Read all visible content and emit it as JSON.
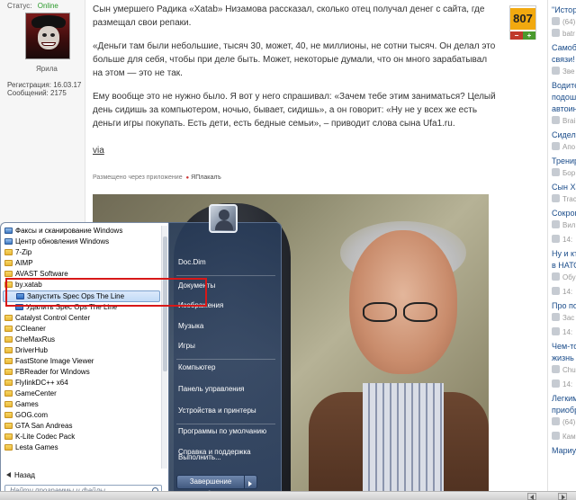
{
  "user": {
    "status_label": "Статус:",
    "status_value": "Online",
    "name": "Ярила",
    "registered": "Регистрация: 16.03.17",
    "messages": "Сообщений: 2175"
  },
  "article": {
    "p1": "Сын умершего Радика «Xatab» Низамова рассказал, сколько отец получал денег с сайта, где размещал свои репаки.",
    "p2": "«Деньги там были небольшие, тысяч 30, может, 40, не миллионы, не сотни тысяч. Он делал это больше для себя, чтобы при деле быть. Может, некоторые думали, что он много зарабатывал на этом — это не так.",
    "p3": "Ему вообще это не нужно было. Я вот у него спрашивал: «Зачем тебе этим заниматься? Целый день сидишь за компьютером, ночью, бывает, сидишь», а он говорит: «Ну не у всех же есть деньги игры покупать. Есть дети, есть бедные семьи», – приводит слова сына Ufa1.ru.",
    "via": "via",
    "posted_prefix": "Размещено через приложение",
    "posted_app": "ЯПлакалъ"
  },
  "rating": {
    "value": "807",
    "minus": "−",
    "plus": "+"
  },
  "rightbar": {
    "items": [
      {
        "title": "\"Истор",
        "meta": "(64)"
      },
      {
        "title": "",
        "meta": "batr"
      },
      {
        "title": "Самобы",
        "meta": ""
      },
      {
        "title": "связи!",
        "meta": ""
      },
      {
        "title": "",
        "meta": "Зве"
      },
      {
        "title": "Водите",
        "meta": ""
      },
      {
        "title": "подошл",
        "meta": ""
      },
      {
        "title": "автоин",
        "meta": ""
      },
      {
        "title": "",
        "meta": "Brai"
      },
      {
        "title": "Сидела",
        "meta": ""
      },
      {
        "title": "",
        "meta": "Апо"
      },
      {
        "title": "Тренир",
        "meta": ""
      },
      {
        "title": "",
        "meta": "Бор"
      },
      {
        "title": "Сын Ха",
        "meta": ""
      },
      {
        "title": "",
        "meta": "Trac"
      },
      {
        "title": "Сокрoп",
        "meta": ""
      },
      {
        "title": "",
        "meta": "Вил"
      },
      {
        "title": "",
        "meta": "14:"
      },
      {
        "title": "Ну и кт",
        "meta": ""
      },
      {
        "title": "в НАТО",
        "meta": ""
      },
      {
        "title": "",
        "meta": "Обу"
      },
      {
        "title": "",
        "meta": "14:"
      },
      {
        "title": "Про по",
        "meta": ""
      },
      {
        "title": "",
        "meta": "Зас"
      },
      {
        "title": "",
        "meta": "14:"
      },
      {
        "title": "Чем-то",
        "meta": ""
      },
      {
        "title": "жизнь",
        "meta": ""
      },
      {
        "title": "",
        "meta": "Chu"
      },
      {
        "title": "",
        "meta": "14:"
      },
      {
        "title": "Легким",
        "meta": ""
      },
      {
        "title": "приобр",
        "meta": ""
      },
      {
        "title": "",
        "meta": "(64)"
      },
      {
        "title": "",
        "meta": "Кам"
      },
      {
        "title": "Мариу",
        "meta": ""
      }
    ]
  },
  "startmenu": {
    "programs": [
      {
        "label": "Факсы и сканирование Windows",
        "type": "app"
      },
      {
        "label": "Центр обновления Windows",
        "type": "app"
      },
      {
        "label": "7-Zip",
        "type": "folder"
      },
      {
        "label": "AIMP",
        "type": "folder"
      },
      {
        "label": "AVAST Software",
        "type": "folder"
      },
      {
        "label": "by.xatab",
        "type": "folder"
      },
      {
        "label": "Запустить Spec Ops The Line",
        "type": "sub-hl"
      },
      {
        "label": "Удалить Spec Ops The Line",
        "type": "sub"
      },
      {
        "label": "Catalyst Control Center",
        "type": "folder"
      },
      {
        "label": "CCleaner",
        "type": "folder"
      },
      {
        "label": "CheMaxRus",
        "type": "folder"
      },
      {
        "label": "DriverHub",
        "type": "folder"
      },
      {
        "label": "FastStone Image Viewer",
        "type": "folder"
      },
      {
        "label": "FBReader for Windows",
        "type": "folder"
      },
      {
        "label": "FlylinkDC++ x64",
        "type": "folder"
      },
      {
        "label": "GameCenter",
        "type": "folder"
      },
      {
        "label": "Games",
        "type": "folder"
      },
      {
        "label": "GOG.com",
        "type": "folder"
      },
      {
        "label": "GTA San Andreas",
        "type": "folder"
      },
      {
        "label": "K-Lite Codec Pack",
        "type": "folder"
      },
      {
        "label": "Lesta Games",
        "type": "folder"
      }
    ],
    "back_label": "Назад",
    "search_placeholder": "Найти программы и файлы",
    "right_items": [
      "Doc.Dim",
      "Документы",
      "Изображения",
      "Музыка",
      "Игры",
      "Компьютер",
      "Панель управления",
      "Устройства и принтеры",
      "Программы по умолчанию",
      "Справка и поддержка",
      "Выполнить..."
    ],
    "shutdown_label": "Завершение работы"
  },
  "colors": {
    "online": "#2b9a2b",
    "rating_bg": "#f2a90f",
    "highlight_box": "#d81818",
    "link": "#1a4c8a"
  }
}
